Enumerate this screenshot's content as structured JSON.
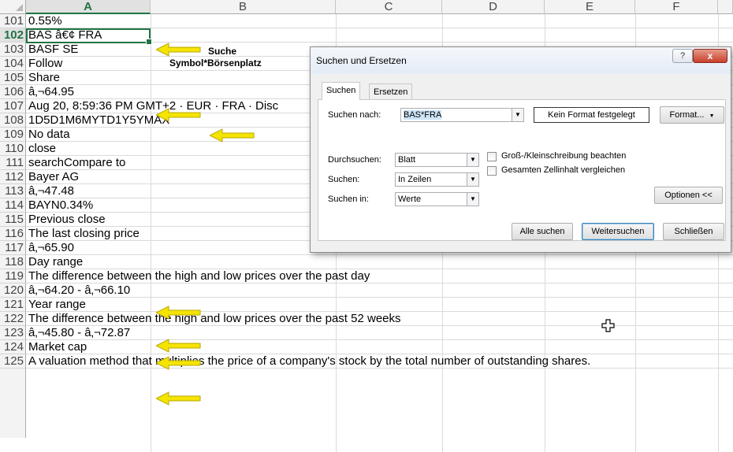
{
  "columns": [
    "A",
    "B",
    "C",
    "D",
    "E",
    "F"
  ],
  "selected_column": "A",
  "selected_row": "102",
  "rows": [
    {
      "num": "101",
      "text": "0.55%"
    },
    {
      "num": "102",
      "text": "BAS â€¢ FRA"
    },
    {
      "num": "103",
      "text": "BASF SE"
    },
    {
      "num": "104",
      "text": "Follow"
    },
    {
      "num": "105",
      "text": "Share"
    },
    {
      "num": "106",
      "text": "â‚¬64.95"
    },
    {
      "num": "107",
      "text": "Aug 20, 8:59:36 PM GMT+2 · EUR · FRA · Disc"
    },
    {
      "num": "108",
      "text": "1D5D1M6MYTD1Y5YMAX"
    },
    {
      "num": "109",
      "text": "No data"
    },
    {
      "num": "110",
      "text": "close"
    },
    {
      "num": "111",
      "text": "searchCompare to"
    },
    {
      "num": "112",
      "text": "Bayer AG"
    },
    {
      "num": "113",
      "text": "â‚¬47.48"
    },
    {
      "num": "114",
      "text": "BAYN0.34%"
    },
    {
      "num": "115",
      "text": "Previous close"
    },
    {
      "num": "116",
      "text": "The last closing price"
    },
    {
      "num": "117",
      "text": "â‚¬65.90"
    },
    {
      "num": "118",
      "text": "Day range"
    },
    {
      "num": "119",
      "text": "The difference between the high and low prices over the past day"
    },
    {
      "num": "120",
      "text": "â‚¬64.20 - â‚¬66.10"
    },
    {
      "num": "121",
      "text": "Year range"
    },
    {
      "num": "122",
      "text": "The difference between the high and low prices over the past 52 weeks"
    },
    {
      "num": "123",
      "text": "â‚¬45.80 - â‚¬72.87"
    },
    {
      "num": "124",
      "text": "Market cap"
    },
    {
      "num": "125",
      "text": "A valuation method that multiplies the price of a company's stock by the total number of outstanding shares."
    }
  ],
  "annotation": {
    "line1": "Suche",
    "line2": "Symbol*Börsenplatz"
  },
  "arrow_color": "#f5e400",
  "accent_color": "#217346",
  "dialog": {
    "title": "Suchen und Ersetzen",
    "help_label": "?",
    "close_label": "x",
    "tabs": [
      "Suchen",
      "Ersetzen"
    ],
    "find_label": "Suchen nach:",
    "find_value": "BAS*FRA",
    "format_status": "Kein Format festgelegt",
    "format_button": "Format...",
    "within_label": "Durchsuchen:",
    "within_value": "Blatt",
    "search_label": "Suchen:",
    "search_value": "In Zeilen",
    "lookin_label": "Suchen in:",
    "lookin_value": "Werte",
    "match_case_label": "Groß-/Kleinschreibung beachten",
    "match_entire_label": "Gesamten Zellinhalt vergleichen",
    "options_button": "Optionen <<",
    "find_all_button": "Alle suchen",
    "find_next_button": "Weitersuchen",
    "close_button": "Schließen"
  }
}
